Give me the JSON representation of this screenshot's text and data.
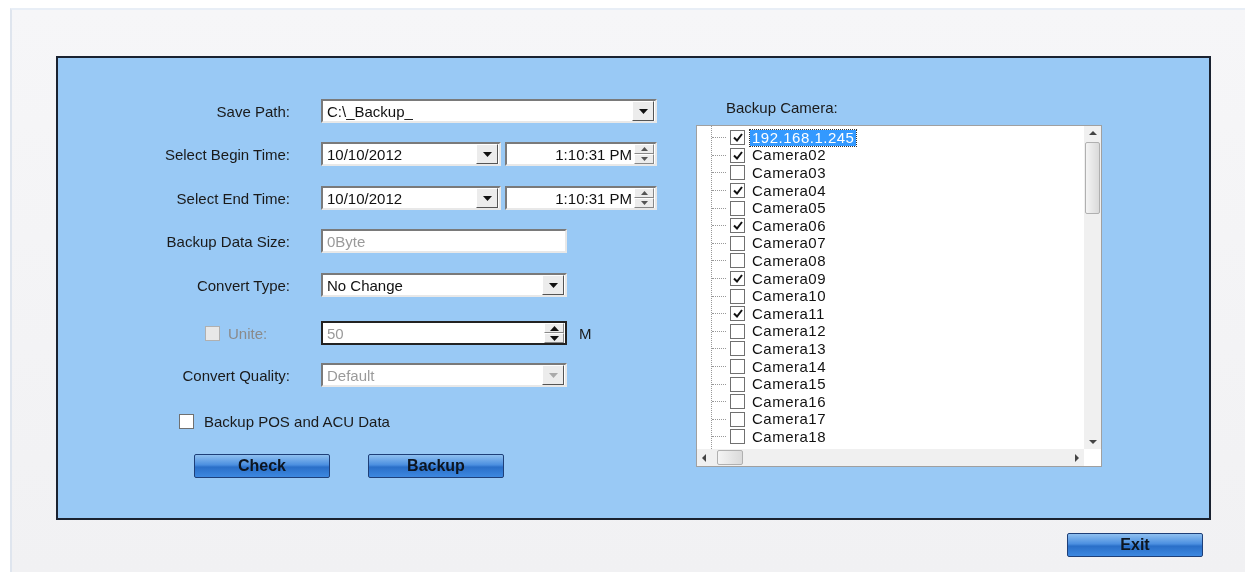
{
  "form": {
    "save_path": {
      "label": "Save Path:",
      "value": "C:\\_Backup_"
    },
    "begin_time": {
      "label": "Select Begin Time:",
      "date": "10/10/2012",
      "time": "1:10:31 PM"
    },
    "end_time": {
      "label": "Select End Time:",
      "date": "10/10/2012",
      "time": "1:10:31 PM"
    },
    "data_size": {
      "label": "Backup Data Size:",
      "value": "0Byte",
      "disabled": true
    },
    "convert_type": {
      "label": "Convert Type:",
      "value": "No Change"
    },
    "unite": {
      "label": "Unite:",
      "checked": false,
      "disabled": true,
      "value": "50",
      "unit": "M"
    },
    "convert_quality": {
      "label": "Convert Quality:",
      "value": "Default",
      "disabled": true
    },
    "backup_pos": {
      "label": "Backup POS and ACU Data",
      "checked": false
    }
  },
  "buttons": [
    {
      "label": "Check"
    },
    {
      "label": "Backup"
    }
  ],
  "cameras": {
    "label": "Backup Camera:",
    "items": [
      {
        "name": "192.168.1.245",
        "checked": true,
        "selected": true
      },
      {
        "name": "Camera02",
        "checked": true,
        "selected": false
      },
      {
        "name": "Camera03",
        "checked": false,
        "selected": false
      },
      {
        "name": "Camera04",
        "checked": true,
        "selected": false
      },
      {
        "name": "Camera05",
        "checked": false,
        "selected": false
      },
      {
        "name": "Camera06",
        "checked": true,
        "selected": false
      },
      {
        "name": "Camera07",
        "checked": false,
        "selected": false
      },
      {
        "name": "Camera08",
        "checked": false,
        "selected": false
      },
      {
        "name": "Camera09",
        "checked": true,
        "selected": false
      },
      {
        "name": "Camera10",
        "checked": false,
        "selected": false
      },
      {
        "name": "Camera11",
        "checked": true,
        "selected": false
      },
      {
        "name": "Camera12",
        "checked": false,
        "selected": false
      },
      {
        "name": "Camera13",
        "checked": false,
        "selected": false
      },
      {
        "name": "Camera14",
        "checked": false,
        "selected": false
      },
      {
        "name": "Camera15",
        "checked": false,
        "selected": false
      },
      {
        "name": "Camera16",
        "checked": false,
        "selected": false
      },
      {
        "name": "Camera17",
        "checked": false,
        "selected": false
      },
      {
        "name": "Camera18",
        "checked": false,
        "selected": false
      }
    ]
  },
  "exit_button": {
    "label": "Exit"
  }
}
